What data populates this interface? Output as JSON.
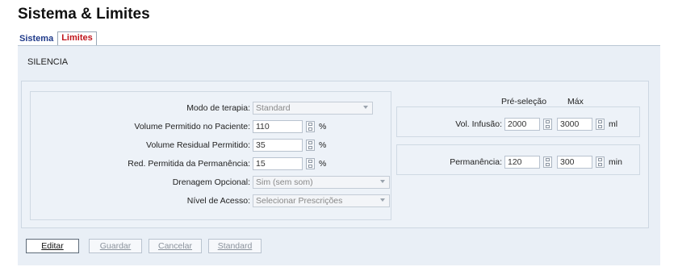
{
  "title": "Sistema & Limites",
  "tabs": [
    {
      "label": "Sistema",
      "active": false
    },
    {
      "label": "Limites",
      "active": true
    }
  ],
  "mode_label": "SILENCIA",
  "form": {
    "modo_terapia": {
      "label": "Modo de terapia:",
      "value": "Standard"
    },
    "vol_permitido": {
      "label": "Volume Permitido no Paciente:",
      "value": "110",
      "unit": "%"
    },
    "vol_residual": {
      "label": "Volume Residual Permitido:",
      "value": "35",
      "unit": "%"
    },
    "red_permanencia": {
      "label": "Red. Permitida da Permanência:",
      "value": "15",
      "unit": "%"
    },
    "drenagem": {
      "label": "Drenagem Opcional:",
      "value": "Sim (sem som)"
    },
    "nivel_acesso": {
      "label": "Nível de Acesso:",
      "value": "Selecionar Prescrições"
    }
  },
  "limits": {
    "header_preselection": "Pré-seleção",
    "header_max": "Máx",
    "vol_infusao": {
      "label": "Vol. Infusão:",
      "pre": "2000",
      "max": "3000",
      "unit": "ml"
    },
    "permanencia": {
      "label": "Permanência:",
      "pre": "120",
      "max": "300",
      "unit": "min"
    }
  },
  "buttons": {
    "editar": "Editar",
    "guardar": "Guardar",
    "cancelar": "Cancelar",
    "standard": "Standard"
  },
  "icons": [
    "spinner-icon",
    "dropdown-caret-icon"
  ]
}
